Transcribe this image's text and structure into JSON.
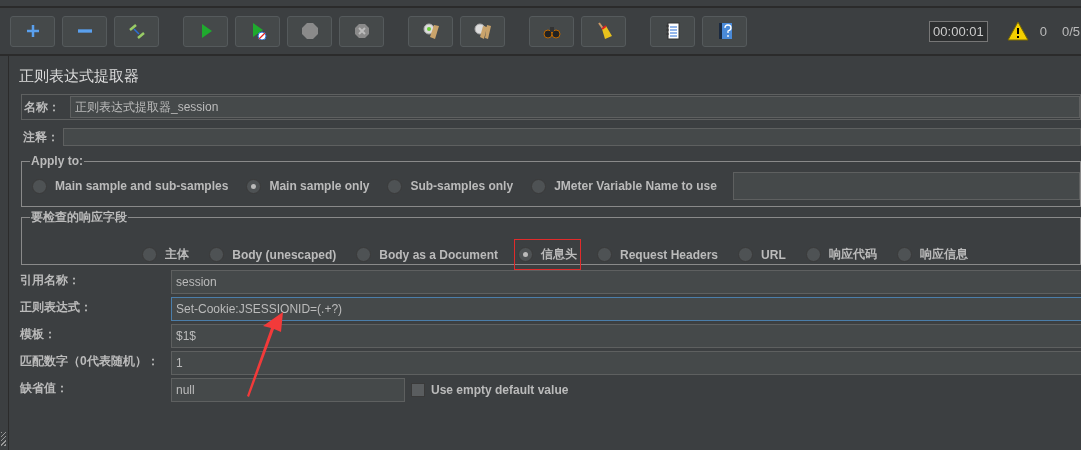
{
  "toolbar": {
    "buttons": [
      {
        "kind": "add"
      },
      {
        "kind": "remove"
      },
      {
        "kind": "toggle"
      },
      {
        "kind": "start"
      },
      {
        "kind": "start-no-pause"
      },
      {
        "kind": "stop"
      },
      {
        "kind": "shutdown"
      },
      {
        "kind": "clear"
      },
      {
        "kind": "clear-all"
      },
      {
        "kind": "search"
      },
      {
        "kind": "reset"
      },
      {
        "kind": "functions"
      },
      {
        "kind": "help"
      }
    ],
    "timer": "00:00:01",
    "warnings": "0",
    "threads": "0/5"
  },
  "panel": {
    "title": "正则表达式提取器",
    "name": {
      "label": "名称：",
      "value": "正则表达式提取器_session"
    },
    "comment": {
      "label": "注释："
    },
    "apply_to": {
      "legend": "Apply to:",
      "options": [
        {
          "label": "Main sample and sub-samples",
          "selected": false
        },
        {
          "label": "Main sample only",
          "selected": true
        },
        {
          "label": "Sub-samples only",
          "selected": false
        },
        {
          "label": "JMeter Variable Name to use",
          "selected": false
        }
      ]
    },
    "field_to_check": {
      "legend": "要检查的响应字段",
      "options": [
        {
          "label": "主体",
          "selected": false,
          "highlighted": false
        },
        {
          "label": "Body (unescaped)",
          "selected": false,
          "highlighted": false
        },
        {
          "label": "Body as a Document",
          "selected": false,
          "highlighted": false
        },
        {
          "label": "信息头",
          "selected": true,
          "highlighted": true
        },
        {
          "label": "Request Headers",
          "selected": false,
          "highlighted": false
        },
        {
          "label": "URL",
          "selected": false,
          "highlighted": false
        },
        {
          "label": "响应代码",
          "selected": false,
          "highlighted": false
        },
        {
          "label": "响应信息",
          "selected": false,
          "highlighted": false
        }
      ]
    },
    "fields": [
      {
        "label": "引用名称：",
        "value": "session",
        "focused": false
      },
      {
        "label": "正则表达式：",
        "value": "Set-Cookie:JSESSIONID=(.+?)",
        "focused": true
      },
      {
        "label": "模板：",
        "value": "$1$",
        "focused": false
      },
      {
        "label": "匹配数字（0代表随机）：",
        "value": "1",
        "focused": false
      },
      {
        "label": "缺省值：",
        "value": "null",
        "focused": false,
        "checkbox": {
          "label": "Use empty default value",
          "checked": false
        }
      }
    ]
  },
  "annotations": [
    {
      "kind": "arrow"
    }
  ]
}
